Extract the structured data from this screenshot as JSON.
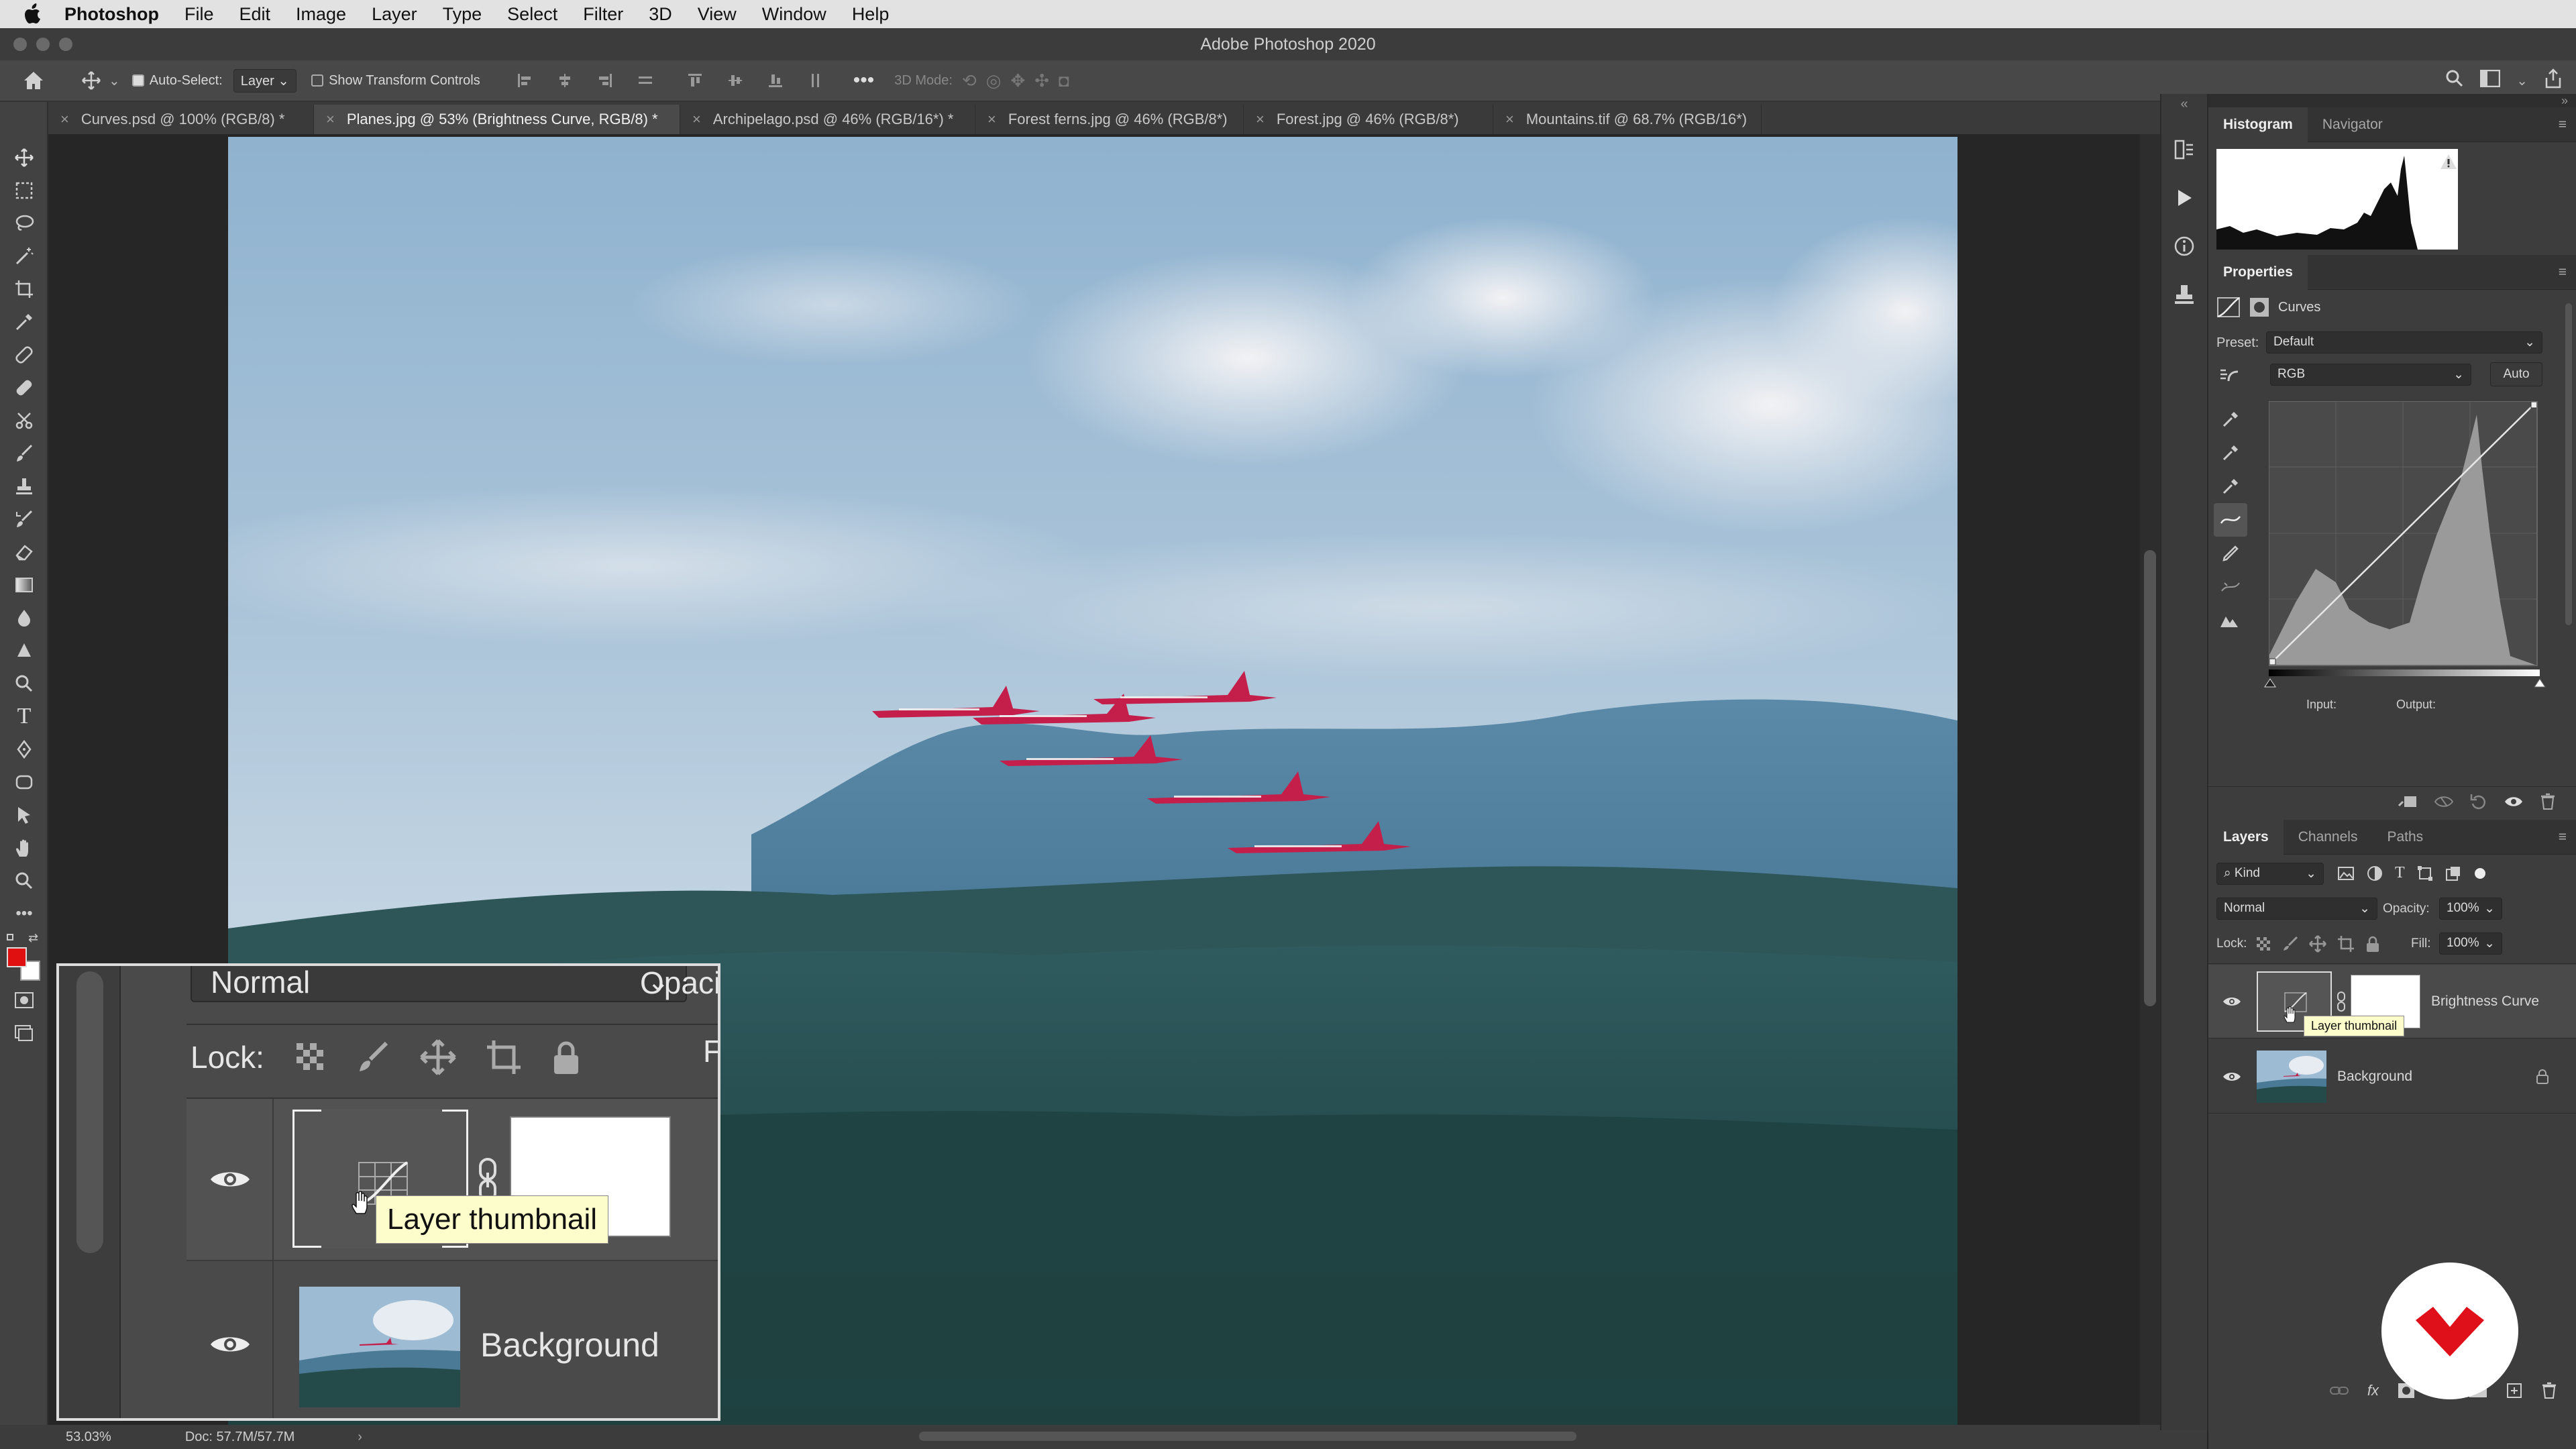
{
  "menubar": {
    "app_name": "Photoshop",
    "items": [
      "File",
      "Edit",
      "Image",
      "Layer",
      "Type",
      "Select",
      "Filter",
      "3D",
      "View",
      "Window",
      "Help"
    ]
  },
  "window": {
    "title": "Adobe Photoshop 2020"
  },
  "options_bar": {
    "auto_select_label": "Auto-Select:",
    "auto_select_value": "Layer",
    "show_transform_label": "Show Transform Controls",
    "mode_3d_label": "3D Mode:"
  },
  "tabs": [
    {
      "label": "Curves.psd @ 100% (RGB/8) *",
      "active": false
    },
    {
      "label": "Planes.jpg @ 53% (Brightness Curve, RGB/8) *",
      "active": true
    },
    {
      "label": "Archipelago.psd @ 46% (RGB/16*) *",
      "active": false
    },
    {
      "label": "Forest ferns.jpg @ 46% (RGB/8*)",
      "active": false
    },
    {
      "label": "Forest.jpg @ 46% (RGB/8*)",
      "active": false
    },
    {
      "label": "Mountains.tif @ 68.7% (RGB/16*)",
      "active": false
    }
  ],
  "status": {
    "zoom": "53.03%",
    "doc": "Doc: 57.7M/57.7M"
  },
  "histogram_panel": {
    "tabs": [
      "Histogram",
      "Navigator"
    ]
  },
  "properties_panel": {
    "title": "Properties",
    "adjustment": "Curves",
    "preset_label": "Preset:",
    "preset_value": "Default",
    "channel_value": "RGB",
    "auto_label": "Auto",
    "input_label": "Input:",
    "output_label": "Output:"
  },
  "layers_panel": {
    "tabs": [
      "Layers",
      "Channels",
      "Paths"
    ],
    "kind_label": "Kind",
    "blend_mode": "Normal",
    "opacity_label": "Opacity:",
    "opacity_value": "100%",
    "lock_label": "Lock:",
    "fill_label": "Fill:",
    "fill_value": "100%",
    "layers": [
      {
        "name": "Brightness Curve"
      },
      {
        "name": "Background"
      }
    ],
    "tooltip": "Layer thumbnail"
  },
  "zoom_callout": {
    "blend_mode": "Normal",
    "opacity_partial": "Opaci",
    "lock_label": "Lock:",
    "fill_partial": "F",
    "tooltip": "Layer thumbnail",
    "background_label": "Background"
  },
  "colors": {
    "foreground": "#e01010",
    "background": "#ffffff",
    "accent_logo": "#e0101a"
  }
}
